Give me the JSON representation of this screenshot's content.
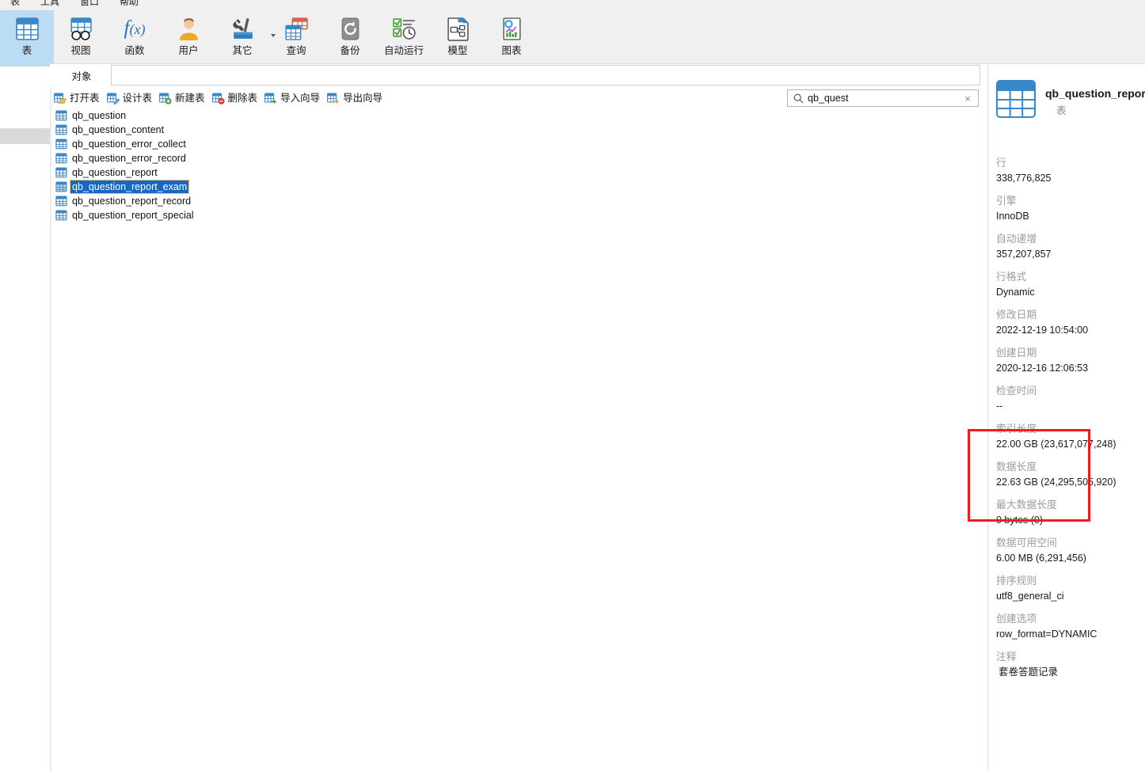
{
  "menubar": {
    "items": [
      {
        "label": "表",
        "name": "menu-hidden-left"
      },
      {
        "label": "工具",
        "name": "menu-tools"
      },
      {
        "label": "窗口",
        "name": "menu-window"
      },
      {
        "label": "帮助",
        "name": "menu-help"
      }
    ]
  },
  "ribbon": {
    "items": [
      {
        "label": "表",
        "icon": "table-icon",
        "active": true
      },
      {
        "label": "视图",
        "icon": "view-icon",
        "active": false
      },
      {
        "label": "函数",
        "icon": "function-icon",
        "active": false
      },
      {
        "label": "用户",
        "icon": "user-icon",
        "active": false
      },
      {
        "label": "其它",
        "icon": "others-icon",
        "active": false,
        "caret": true
      },
      {
        "label": "查询",
        "icon": "query-icon",
        "active": false
      },
      {
        "label": "备份",
        "icon": "backup-icon",
        "active": false
      },
      {
        "label": "自动运行",
        "icon": "automation-icon",
        "active": false
      },
      {
        "label": "模型",
        "icon": "model-icon",
        "active": false
      },
      {
        "label": "图表",
        "icon": "chart-icon",
        "active": false
      }
    ]
  },
  "object_strip": {
    "tab_label": "对象",
    "path_value": ""
  },
  "actionbar": {
    "buttons": [
      {
        "label": "打开表",
        "icon": "open-table-icon"
      },
      {
        "label": "设计表",
        "icon": "design-table-icon"
      },
      {
        "label": "新建表",
        "icon": "new-table-icon"
      },
      {
        "label": "删除表",
        "icon": "delete-table-icon"
      },
      {
        "label": "导入向导",
        "icon": "import-wizard-icon"
      },
      {
        "label": "导出向导",
        "icon": "export-wizard-icon"
      }
    ]
  },
  "search": {
    "value": "qb_quest",
    "placeholder": "",
    "icon": "search-icon",
    "clear_icon": "×"
  },
  "table_list": {
    "items": [
      {
        "name": "qb_question",
        "selected": false
      },
      {
        "name": "qb_question_content",
        "selected": false
      },
      {
        "name": "qb_question_error_collect",
        "selected": false
      },
      {
        "name": "qb_question_error_record",
        "selected": false
      },
      {
        "name": "qb_question_report",
        "selected": false
      },
      {
        "name": "qb_question_report_exam",
        "selected": true
      },
      {
        "name": "qb_question_report_record",
        "selected": false
      },
      {
        "name": "qb_question_report_special",
        "selected": false
      }
    ]
  },
  "info_panel": {
    "title": "qb_question_report_exam",
    "subtitle": "表",
    "icon": "table-large-icon",
    "properties": [
      {
        "key": "行",
        "value": "338,776,825"
      },
      {
        "key": "引擎",
        "value": "InnoDB"
      },
      {
        "key": "自动递增",
        "value": "357,207,857"
      },
      {
        "key": "行格式",
        "value": "Dynamic"
      },
      {
        "key": "修改日期",
        "value": "2022-12-19 10:54:00"
      },
      {
        "key": "创建日期",
        "value": "2020-12-16 12:06:53"
      },
      {
        "key": "检查时间",
        "value": "--"
      },
      {
        "key": "索引长度",
        "value": "22.00 GB (23,617,077,248)"
      },
      {
        "key": "数据长度",
        "value": "22.63 GB (24,295,505,920)"
      },
      {
        "key": "最大数据长度",
        "value": "0 bytes (0)"
      },
      {
        "key": "数据可用空间",
        "value": "6.00 MB (6,291,456)"
      },
      {
        "key": "排序规则",
        "value": "utf8_general_ci"
      },
      {
        "key": "创建选项",
        "value": "row_format=DYNAMIC"
      },
      {
        "key": "注释",
        "value": "套卷答题记录"
      }
    ]
  },
  "annotation": {
    "color": "#ee1c1c",
    "label": "highlight-index-and-data-length"
  }
}
